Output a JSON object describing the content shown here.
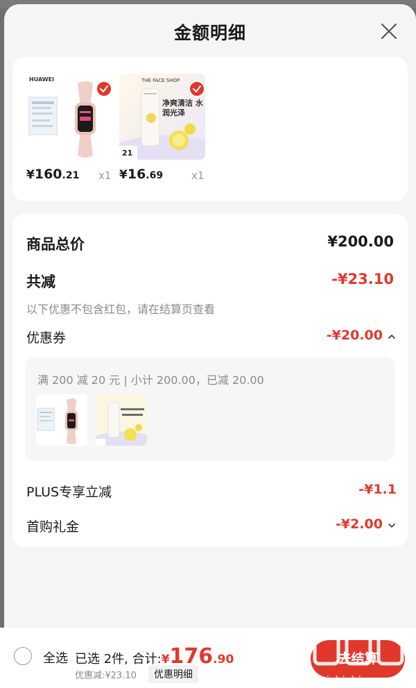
{
  "sheet": {
    "title": "金额明细"
  },
  "products": [
    {
      "brand": "HUAWEI",
      "price_symbol": "¥",
      "price_int": "160",
      "price_dec": ".21",
      "qty": "x1"
    },
    {
      "brand": "THE FACE SHOP",
      "tagline": "净爽清洁 水润光泽",
      "mini_price": "21",
      "price_symbol": "¥",
      "price_int": "16",
      "price_dec": ".69",
      "qty": "x1"
    }
  ],
  "details": {
    "total_label": "商品总价",
    "total_value": "¥200.00",
    "reduce_label": "共减",
    "reduce_value": "-¥23.10",
    "note": "以下优惠不包含红包，请在结算页查看",
    "coupon_label": "优惠券",
    "coupon_value": "-¥20.00",
    "coupon_desc": "满 200 减 20 元 | 小计 200.00，已减 20.00",
    "plus_label": "PLUS专享立减",
    "plus_value": "-¥1.1",
    "first_label": "首购礼金",
    "first_value": "-¥2.00"
  },
  "bottom": {
    "select_all": "全选",
    "selected_text": "已选 2件, 合计:",
    "total_symbol": "¥",
    "total_int": "176",
    "total_dec": ".90",
    "discount_text": "优惠减:¥23.10",
    "detail_link": "优惠明细",
    "checkout_label": "去结算",
    "watermark": "zhizhizhi.com"
  },
  "colors": {
    "accent": "#e1382c",
    "background": "#f5f5f5"
  }
}
